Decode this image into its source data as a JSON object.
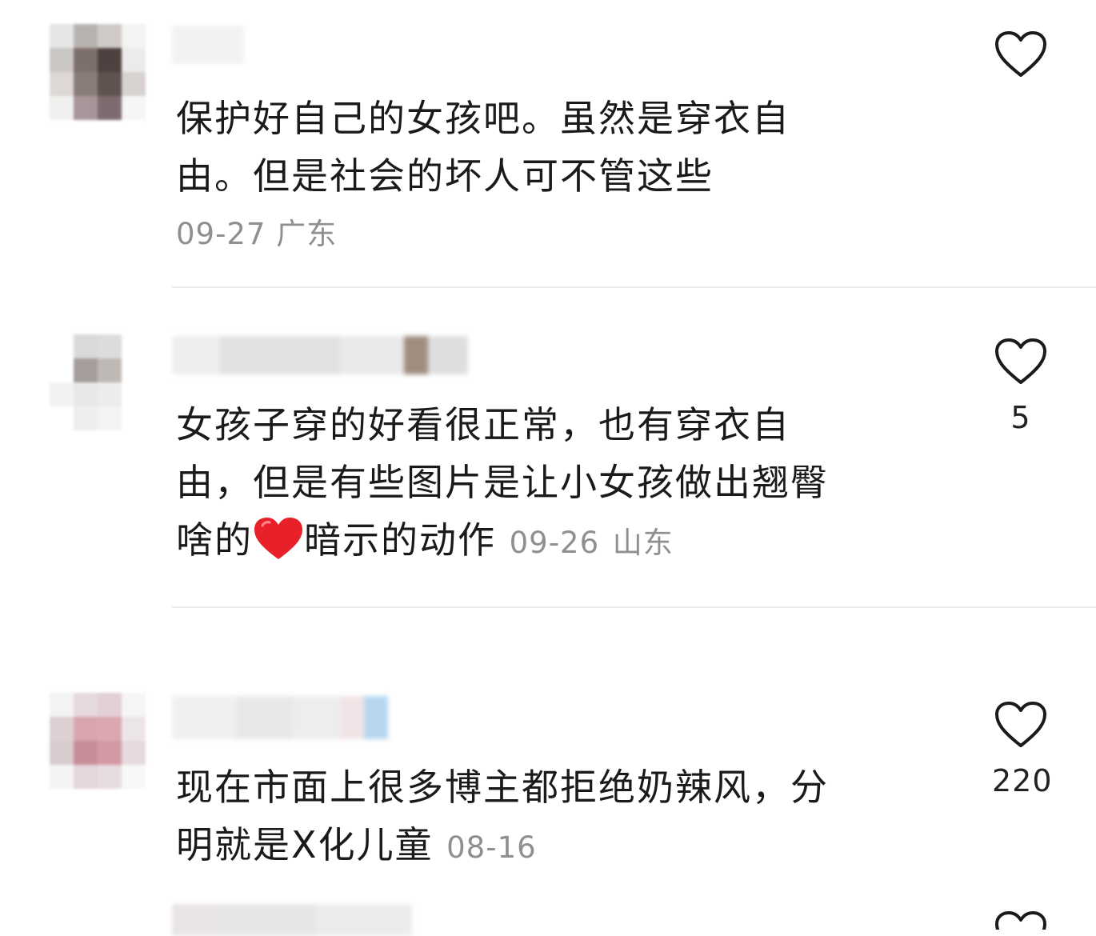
{
  "comments": [
    {
      "text_line1": "保护好自己的女孩吧。虽然是穿衣自",
      "text_line2": "由。但是社会的坏人可不管这些",
      "date": "09-27",
      "location": "广东",
      "likes": ""
    },
    {
      "text_line1": "女孩子穿的好看很正常，也有穿衣自",
      "text_line2": "由，但是有些图片是让小女孩做出翘臀",
      "text_line3_before": "啥的",
      "text_line3_after": "暗示的动作",
      "emoji": "red-heart-icon",
      "date": "09-26",
      "location": "山东",
      "likes": "5"
    },
    {
      "text_line1": "现在市面上很多博主都拒绝奶辣风，分",
      "text_line2_before": "明就是X化儿童",
      "date": "08-16",
      "location": "",
      "likes": "220"
    }
  ],
  "colors": {
    "heart_stroke": "#1a1a1a",
    "meta_gray": "#8f8f8f",
    "emoji_red": "#e8202a"
  }
}
